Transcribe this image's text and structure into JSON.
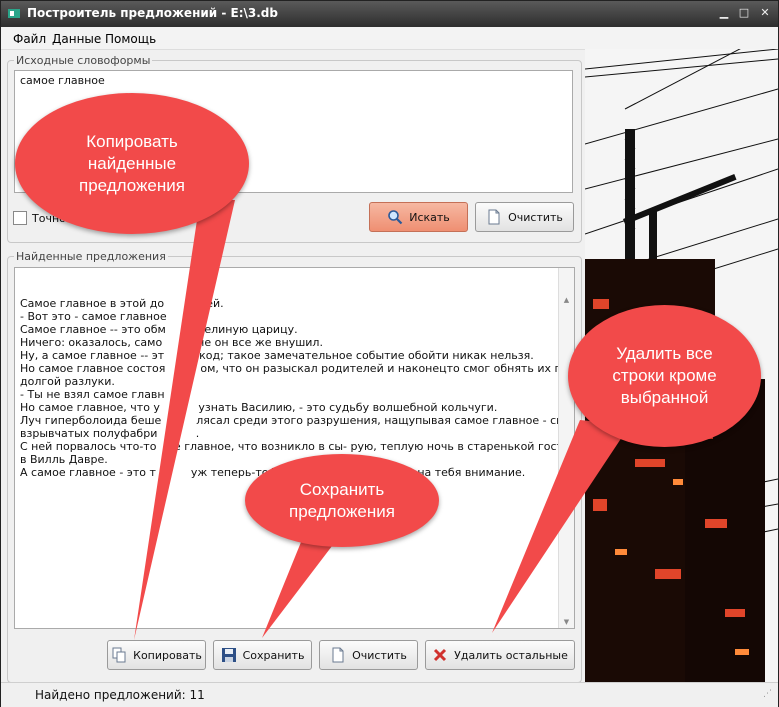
{
  "window": {
    "title": "Построитель предложений - E:\\3.db"
  },
  "menu": [
    "Файл",
    "Данные",
    "Помощь"
  ],
  "source": {
    "legend": "Исходные словоформы",
    "text": "самое главное",
    "checkbox_label": "Точно",
    "search_label": "Искать",
    "clear_label": "Очистить"
  },
  "found": {
    "legend": "Найденные предложения",
    "lines": [
      "Самое главное в этой до          ней.",
      "- Вот это - самое главное",
      "Самое главное -- это обм           елиную царицу.",
      "Ничего: оказалось, само          не он все же внушил.",
      "Ну, а самое главное -- эт          код; такое замечательное событие обойти никак нельзя.",
      "Но самое главное состоя          ом, что он разыскал родителей и наконецто смог обнять их после",
      "долгой разлуки.",
      "- Ты не взял самое главн",
      "Но самое главное, что у           узнать Василию, - это судьбу волшебной кольчуги.",
      "Луч гиперболоида беше          лясал среди этого разрушения, нащупывая самое главное - склады",
      "взрывчатых полуфабри           .",
      "С ней порвалось что-то     е главное, что возникло в сы- рую, теплую ночь в старенькой гостинице",
      "в Вилль Давре.",
      "А самое главное - это т          уж теперь-то Таня Кузовлева обратит на тебя внимание."
    ],
    "copy_label": "Копировать",
    "save_label": "Сохранить",
    "clear_label": "Очистить",
    "delete_others_label": "Удалить остальные"
  },
  "status": {
    "text": "Найдено предложений: 11"
  },
  "callouts": {
    "copy": "Копировать\nнайденные\nпредложения",
    "save": "Сохранить\nпредложения",
    "delete": "Удалить все\nстроки кроме\nвыбранной"
  },
  "colors": {
    "callout": "#f24a4a",
    "search_button": "#ef8f72"
  }
}
